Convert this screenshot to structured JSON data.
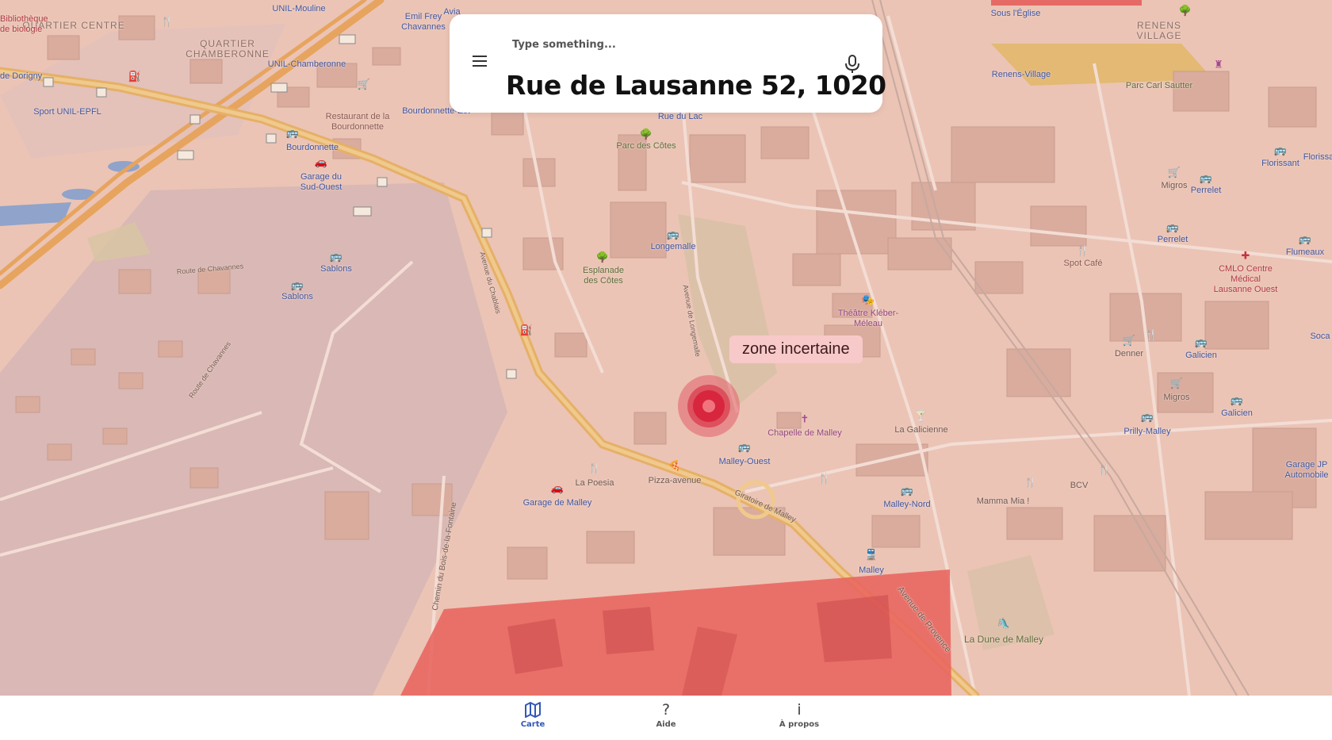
{
  "search": {
    "placeholder": "Type something...",
    "address": "Rue de Lausanne 52, 1020",
    "menu_icon": "hamburger-menu-icon",
    "mic_icon": "microphone-icon"
  },
  "map": {
    "uncertain_zone_label": "zone incertaine",
    "districts": [
      "QUARTIER CENTRE",
      "QUARTIER CHAMBERONNE",
      "RENENS VILLAGE"
    ],
    "places": {
      "biblio": "Bibliothèque\nde biologie",
      "unil_mouline": "UNIL-Mouline",
      "emil_frey": "Emil Frey\nChavannes",
      "avia": "Avia",
      "sous_leglise": "Sous l'Église",
      "renens_village_stop": "Renens-Village",
      "parc_carl_sautter": "Parc Carl Sautter",
      "dorigny": "e de Dorigny",
      "unil_chamberonne": "UNIL-Chamberonne",
      "sport_unil": "Sport UNIL-EPFL",
      "restaurant_bourdonnette": "Restaurant de la\nBourdonnette",
      "bourdonnette_est": "Bourdonnette-Est",
      "bourdonnette": "Bourdonnette",
      "garage_sud_ouest": "Garage du\nSud-Ouest",
      "rue_du_lac": "Rue du Lac",
      "parc_des_cotes": "Parc des Côtes",
      "longemalle": "Longemalle",
      "sablons_1": "Sablons",
      "sablons_2": "Sablons",
      "esplanade": "Esplanade\ndes Côtes",
      "migros_1": "Migros",
      "perrelet_1": "Perrelet",
      "perrelet_2": "Perrelet",
      "florissant": "Florissant",
      "flumeaux": "Flumeaux",
      "spot_cafe": "Spot Café",
      "cmlo": "CMLO Centre\nMédical\nLausanne Ouest",
      "theatre": "Théâtre Kléber-\nMéleau",
      "denner": "Denner",
      "galicien_1": "Galicien",
      "galicien_2": "Galicien",
      "migros_2": "Migros",
      "la_galicienne": "La Galicienne",
      "prilly_malley": "Prilly-Malley",
      "chapelle": "Chapelle de Malley",
      "malley_ouest": "Malley-Ouest",
      "la_poesia": "La Poesia",
      "pizza_avenue": "Pizza-avenue",
      "garage_malley": "Garage de Malley",
      "malley_nord": "Malley-Nord",
      "mamma_mia": "Mamma Mia !",
      "bcv": "BCV",
      "garage_automobile": "Garage JP\nAutomobile",
      "malley": "Malley",
      "dune_malley": "La Dune de Malley",
      "soca": "Soca",
      "florissant_2": "Florissa"
    },
    "streets": [
      "Route de Chavannes",
      "Route de Chavannes",
      "Avenue de Provence",
      "Giratoire de Malley",
      "Chemin du Bois-de-la-Fontaine",
      "Avenue du Chablais",
      "Avenue de Longemalle"
    ],
    "road_shields": [
      "A1A",
      "A1A",
      "A1A",
      "1",
      "1",
      "1",
      "1",
      "1",
      "1",
      "138"
    ]
  },
  "nav": {
    "items": [
      {
        "label": "Carte",
        "icon": "map-icon",
        "active": true
      },
      {
        "label": "Aide",
        "icon": "question-mark-icon",
        "active": false
      },
      {
        "label": "À propos",
        "icon": "info-icon",
        "active": false
      }
    ]
  },
  "colors": {
    "accent": "#3357b8",
    "pin": "#d8263e",
    "zone_fill": "#e8645f",
    "zone_label_bg": "#f8c9c9"
  }
}
